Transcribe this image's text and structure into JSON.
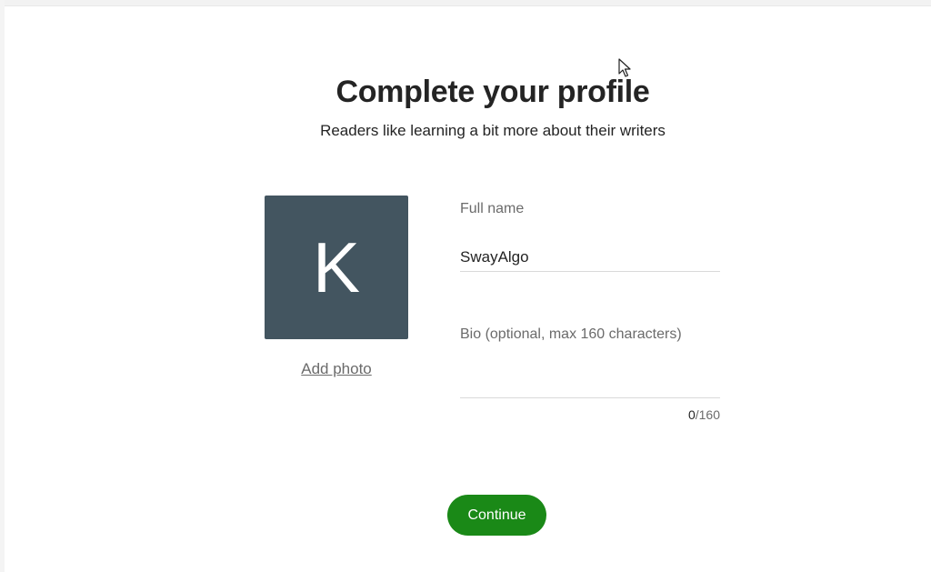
{
  "header": {
    "title": "Complete your profile",
    "subtitle": "Readers like learning a bit more about their writers"
  },
  "avatar": {
    "initial": "K",
    "add_photo_label": "Add photo",
    "background_color": "#435560"
  },
  "form": {
    "full_name_label": "Full name",
    "full_name_value": "SwayAlgo",
    "bio_label": "Bio (optional, max 160 characters)",
    "bio_value": "",
    "bio_count": "0",
    "bio_max": "/160"
  },
  "actions": {
    "continue_label": "Continue",
    "continue_color": "#1a8917"
  },
  "icons": {
    "cursor": "mouse-pointer-icon"
  }
}
